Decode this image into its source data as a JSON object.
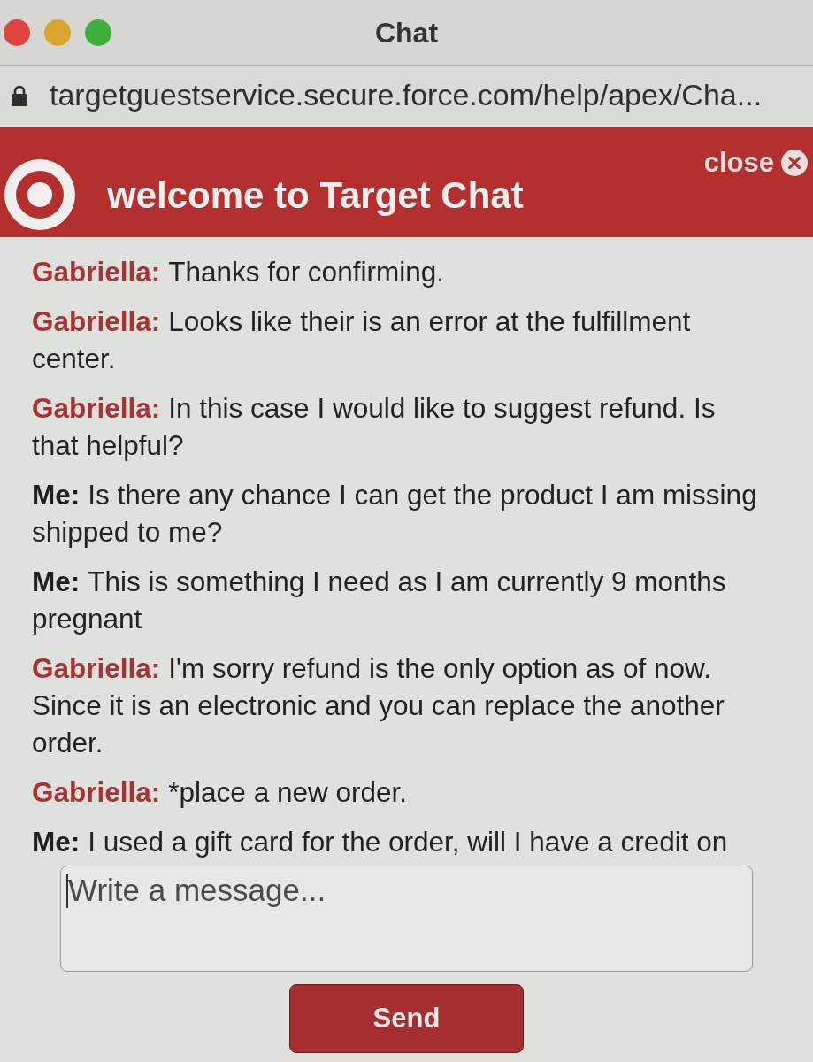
{
  "window": {
    "title": "Chat",
    "url": "targetguestservice.secure.force.com/help/apex/Cha..."
  },
  "chat_header": {
    "title": "welcome to Target Chat",
    "close_label": "close"
  },
  "messages": [
    {
      "kind": "agent",
      "sender": "Gabriella:",
      "text": "Thanks for confirming."
    },
    {
      "kind": "agent",
      "sender": "Gabriella:",
      "text": "Looks like their is an error at the fulfillment center."
    },
    {
      "kind": "agent",
      "sender": "Gabriella:",
      "text": "In this case I would like to suggest refund. Is that helpful?"
    },
    {
      "kind": "customer",
      "sender": "Me:",
      "text": "Is there any chance I can get the product I am missing shipped to me?"
    },
    {
      "kind": "customer",
      "sender": "Me:",
      "text": "This is something I need as I am currently 9 months pregnant"
    },
    {
      "kind": "agent",
      "sender": "Gabriella:",
      "text": "I'm sorry refund is the only option as of now. Since it is an electronic and you can replace the another order."
    },
    {
      "kind": "agent",
      "sender": "Gabriella:",
      "text": "*place a new order."
    },
    {
      "kind": "customer",
      "sender": "Me:",
      "text": "I used a gift card for the order, will I have a credit on"
    }
  ],
  "composer": {
    "placeholder": "Write a message...",
    "send_label": "Send"
  }
}
